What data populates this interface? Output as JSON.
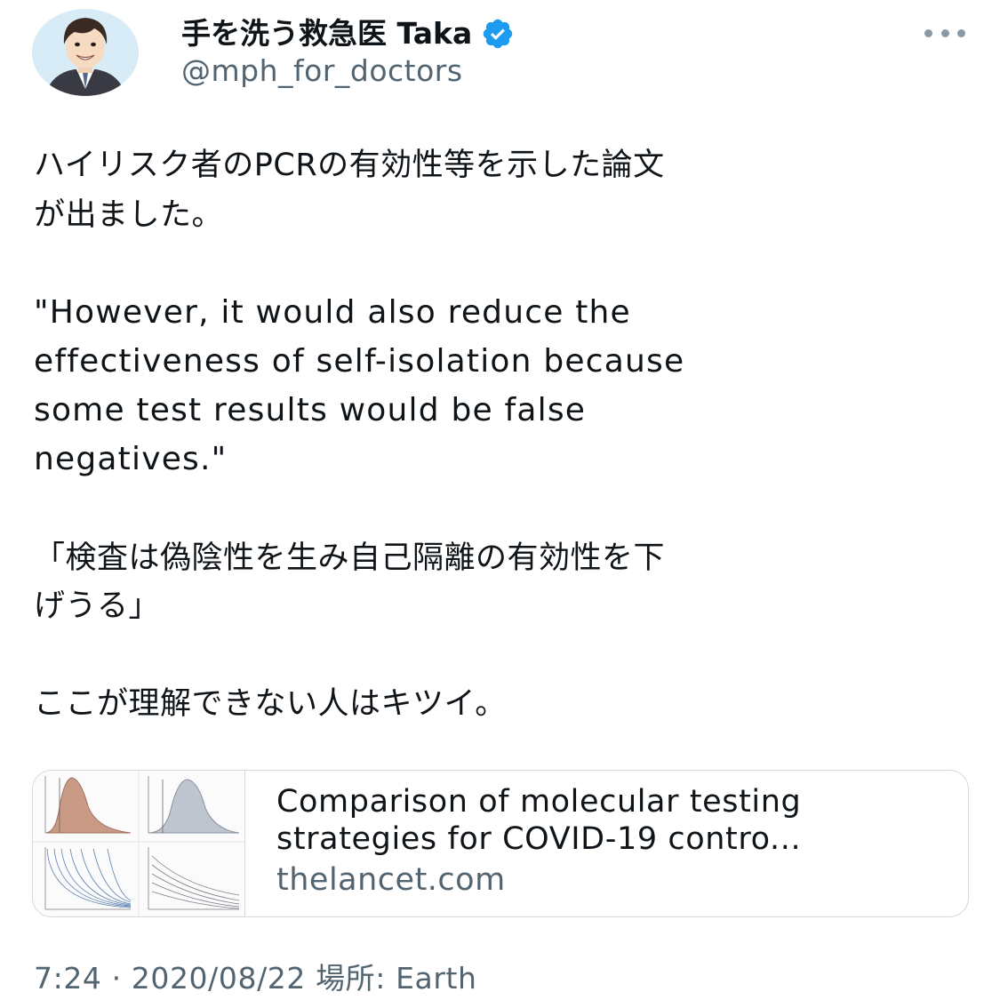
{
  "user": {
    "display_name": "手を洗う救急医 Taka",
    "handle": "@mph_for_doctors"
  },
  "tweet": {
    "lines": [
      "ハイリスク者のPCRの有効性等を示した論文",
      "が出ました。",
      "\"However, it would also reduce the",
      "effectiveness of self-isolation because",
      "some test results would be false",
      "negatives.\"",
      "「検査は偽陰性を生み自己隔離の有効性を下",
      "げうる」",
      "ここが理解できない人はキツイ。"
    ]
  },
  "card": {
    "title_line1": "Comparison of molecular testing",
    "title_line2": "strategies for COVID-19 contro...",
    "domain": "thelancet.com"
  },
  "meta": {
    "text": "7:24 · 2020/08/22 場所: Earth"
  },
  "icons": {
    "verified": "verified-badge-icon",
    "more": "more-options-icon"
  },
  "colors": {
    "verified_blue": "#1d9bf0",
    "secondary_text": "#536471",
    "border": "#cfd9de"
  }
}
